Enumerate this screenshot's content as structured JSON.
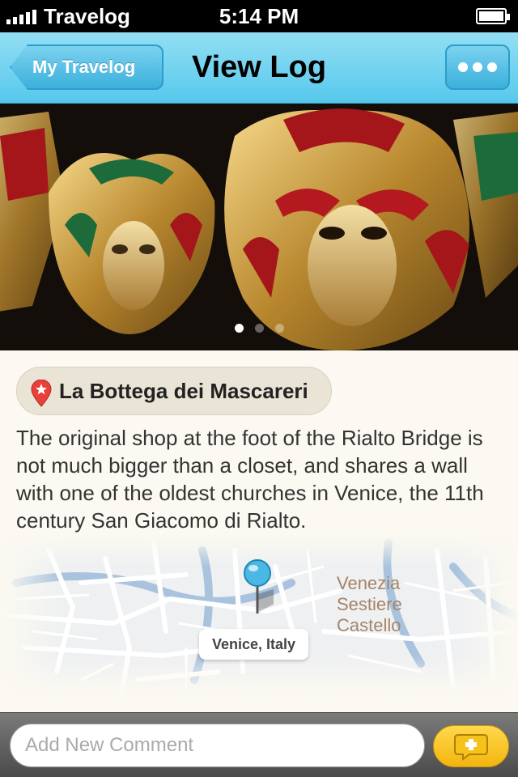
{
  "status_bar": {
    "carrier": "Travelog",
    "time": "5:14 PM",
    "signal_bars": 5,
    "battery_level": 1.0
  },
  "navbar": {
    "back_label": "My Travelog",
    "title": "View Log",
    "more_icon": "ellipsis-icon"
  },
  "carousel": {
    "page_count": 3,
    "active_page": 1,
    "image_subject": "carnival-masks-photo"
  },
  "place": {
    "icon": "map-pin-star-icon",
    "name": "La Bottega dei Mascareri",
    "description": "The original shop at the foot of the Rialto Bridge is not much bigger than a closet, and shares a wall with one of the oldest churches in Venice, the 11th century San Giacomo di Rialto."
  },
  "map": {
    "district_lines": [
      "Venezia",
      "Sestiere",
      "Castello"
    ],
    "callout": "Venice, Italy",
    "pin_icon": "map-pin-icon"
  },
  "comment_bar": {
    "placeholder": "Add New Comment",
    "value": "",
    "add_icon": "add-comment-icon"
  },
  "colors": {
    "navbar": "#56c8ec",
    "accent_yellow": "#f3b50f",
    "background": "#fbf9f1",
    "pin_red": "#e8413a",
    "map_water": "#a9c3de"
  }
}
